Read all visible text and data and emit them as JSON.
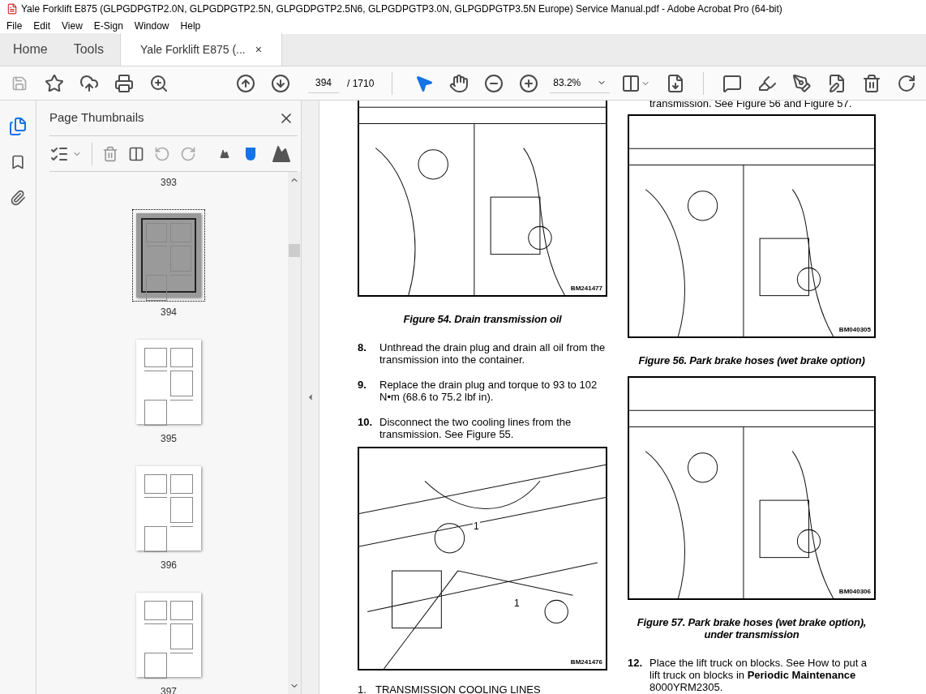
{
  "window": {
    "title": "Yale Forklift E875 (GLPGDPGTP2.0N, GLPGDPGTP2.5N, GLPGDPGTP2.5N6, GLPGDPGTP3.0N, GLPGDPGTP3.5N Europe) Service Manual.pdf - Adobe Acrobat Pro (64-bit)"
  },
  "menu": [
    "File",
    "Edit",
    "View",
    "E-Sign",
    "Window",
    "Help"
  ],
  "tabs": [
    {
      "label": "Home",
      "selected": false,
      "kind": "nav"
    },
    {
      "label": "Tools",
      "selected": false,
      "kind": "nav"
    },
    {
      "label": "Yale Forklift E875 (...",
      "selected": true,
      "kind": "document",
      "close": "×"
    }
  ],
  "toolbar": {
    "page": "394",
    "page_total": "/ 1710",
    "zoom": "83.2%"
  },
  "sidebar": {
    "title": "Page Thumbnails",
    "top_label": "393",
    "thumbnails": [
      {
        "label": "394",
        "selected": true
      },
      {
        "label": "395",
        "selected": false
      },
      {
        "label": "396",
        "selected": false
      },
      {
        "label": "397",
        "selected": false
      }
    ]
  },
  "document": {
    "left": [
      {
        "kind": "figure",
        "code": "BM241477",
        "caption": "Figure 54. Drain transmission oil"
      },
      {
        "kind": "step",
        "number": "8.",
        "text": "Unthread the drain plug and drain all oil from the transmission into the container."
      },
      {
        "kind": "step",
        "number": "9.",
        "text": "Replace the drain plug and torque to 93 to 102 N•m (68.6 to 75.2 lbf in)."
      },
      {
        "kind": "step",
        "number": "10.",
        "text": "Disconnect the two cooling lines from the transmission. See Figure 55."
      },
      {
        "kind": "figure",
        "code": "BM241476",
        "callouts": [
          "1",
          "1"
        ]
      },
      {
        "kind": "legend",
        "number": "1.",
        "text": "TRANSMISSION COOLING LINES"
      }
    ],
    "right": [
      {
        "kind": "text",
        "text": "transmission. See Figure 56 and Figure 57."
      },
      {
        "kind": "figure",
        "code": "BM040305",
        "caption": "Figure 56. Park brake hoses (wet brake option)"
      },
      {
        "kind": "figure",
        "code": "BM040306",
        "caption": "Figure 57. Park brake hoses (wet brake option), under transmission"
      },
      {
        "kind": "step",
        "number": "12.",
        "text": "Place the lift truck on blocks. See How to put a lift truck on blocks in **Periodic Maintenance** 8000YRM2305."
      }
    ]
  }
}
